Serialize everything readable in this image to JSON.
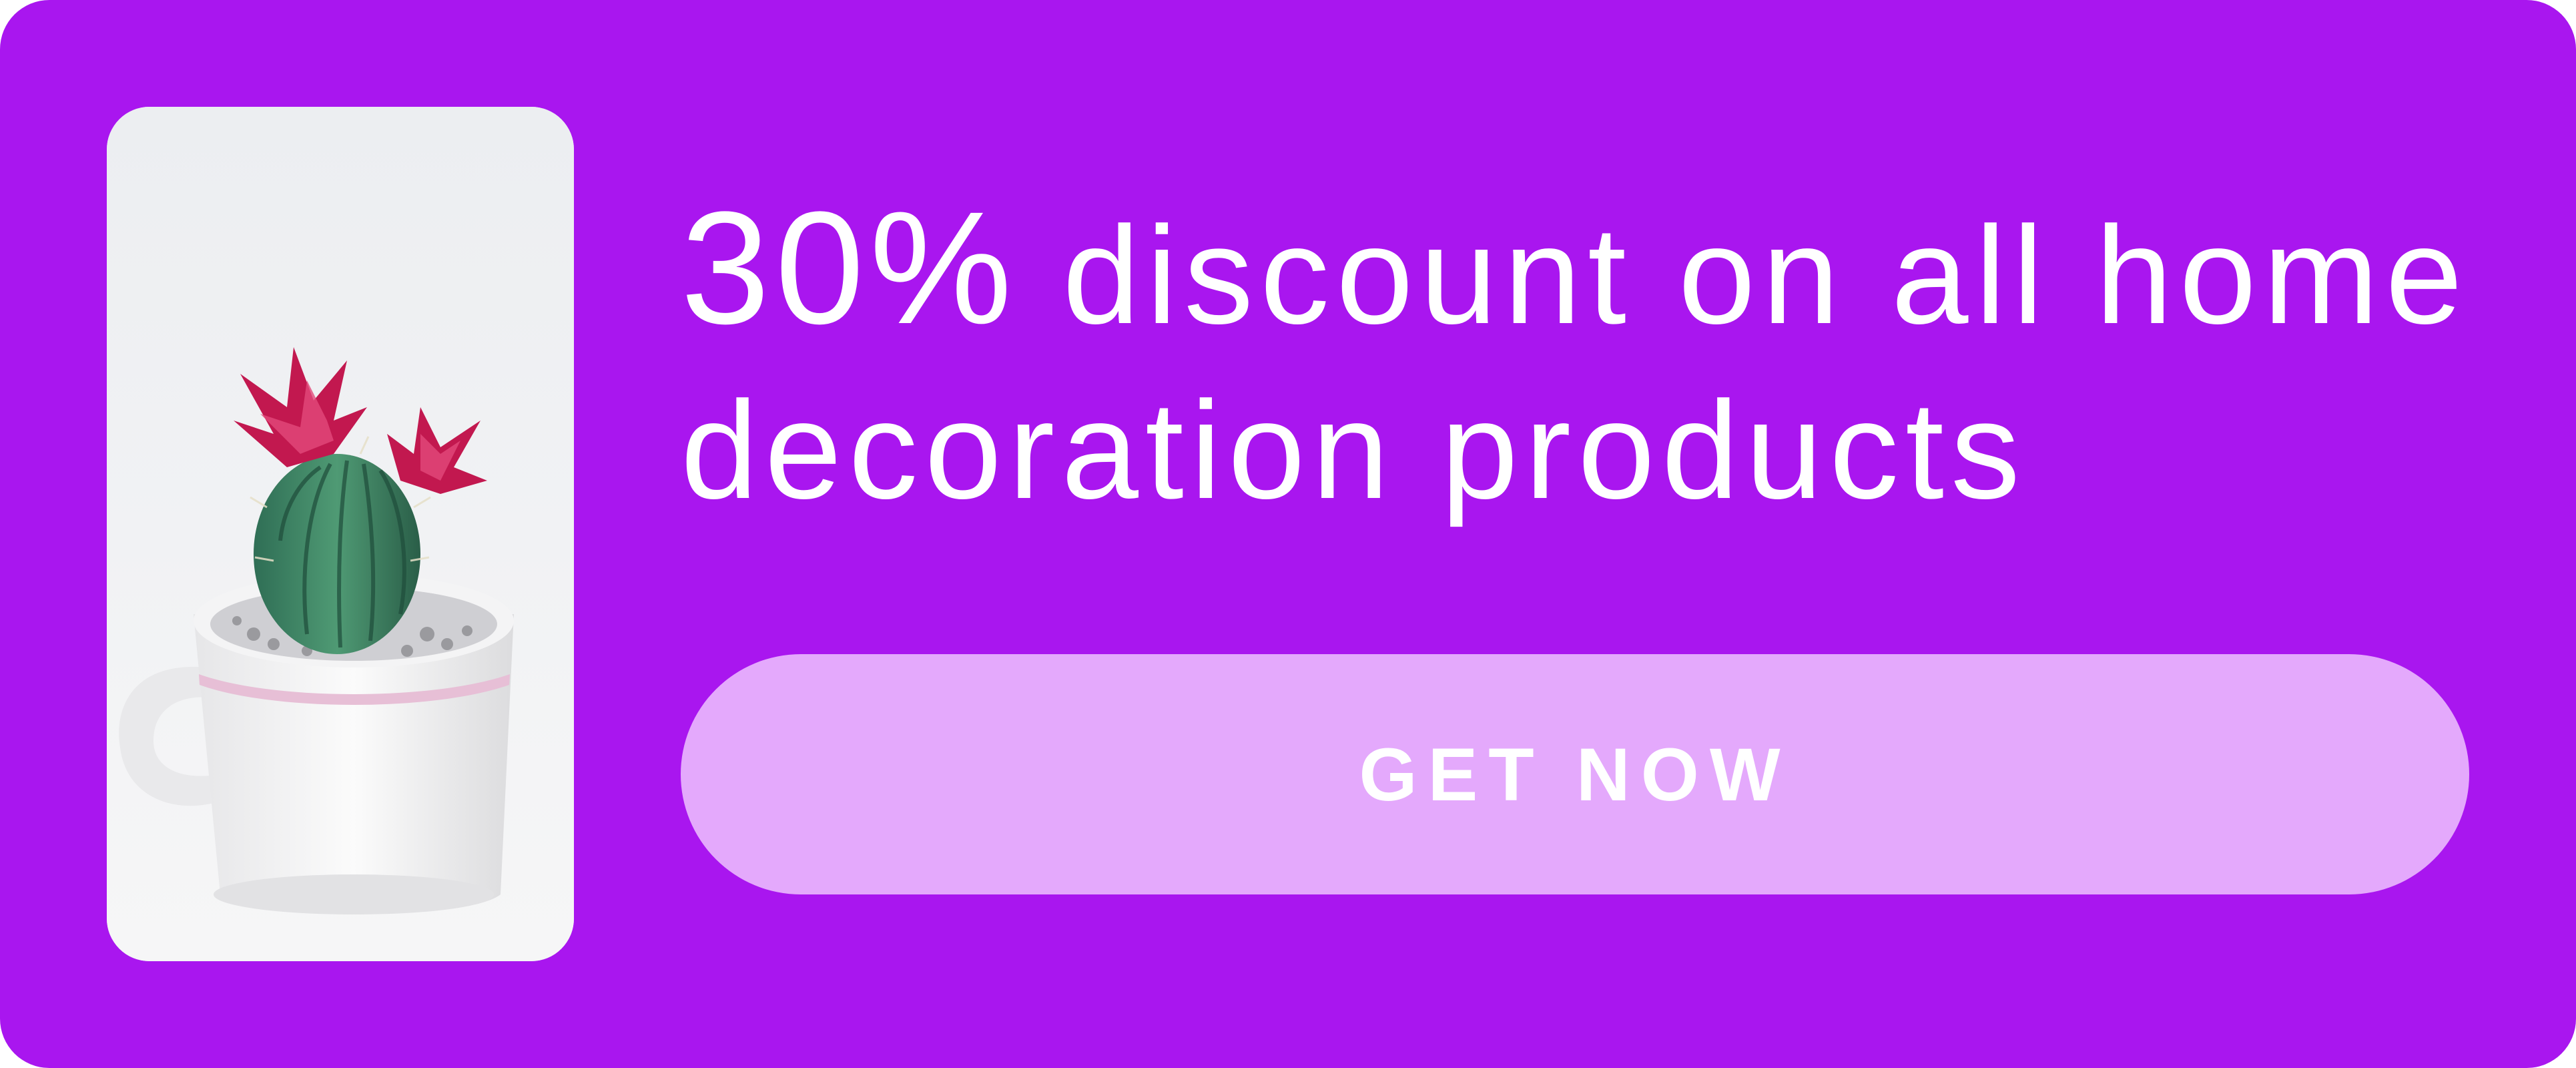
{
  "banner": {
    "headline_prefix": "30%",
    "headline_rest": "discount on all home decoration products",
    "cta_label": "GET NOW",
    "image_icon": "cactus-in-cup-photo",
    "colors": {
      "background": "#a916ef",
      "button": "#e4a9fc",
      "text": "#ffffff"
    }
  }
}
